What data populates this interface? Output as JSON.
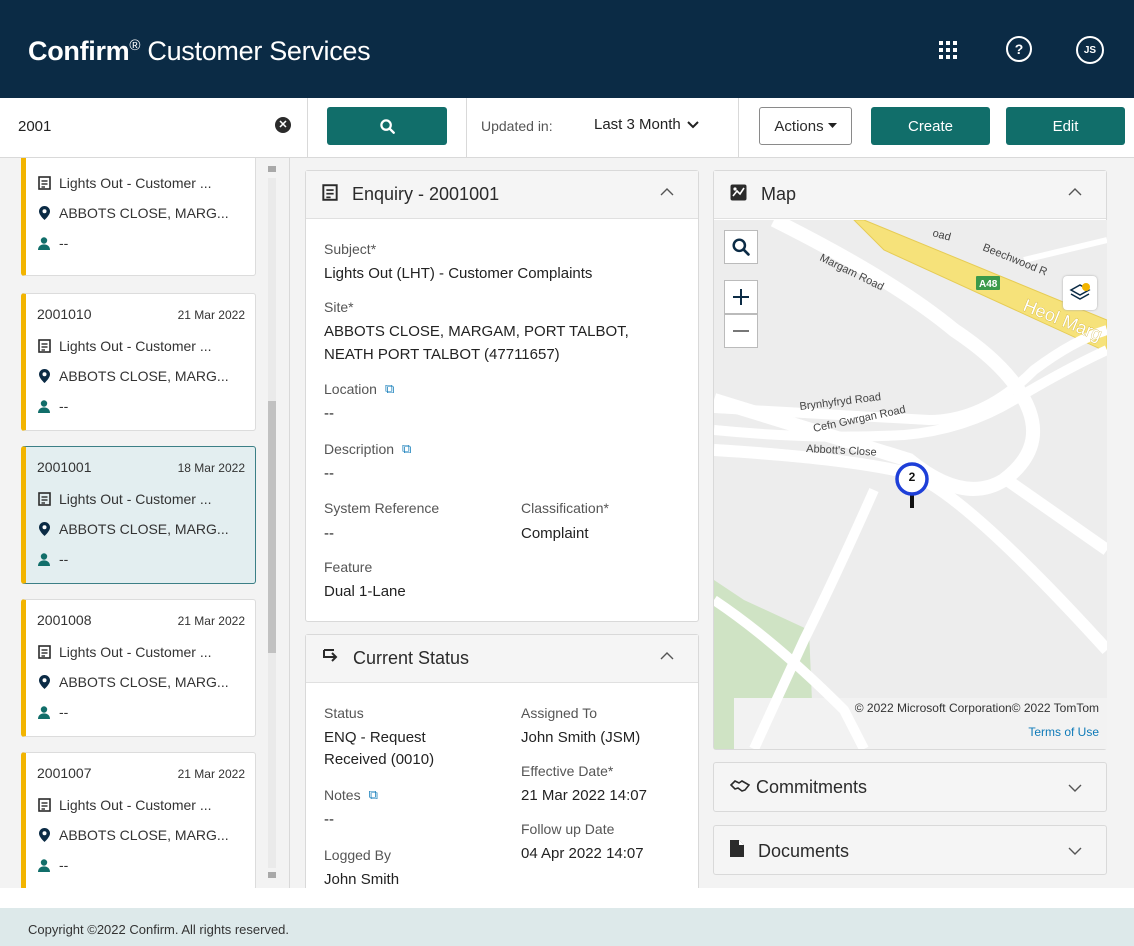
{
  "header": {
    "brand_bold": "Confirm",
    "brand_reg": "®",
    "brand_rest": " Customer Services",
    "help_glyph": "?",
    "user_initials": "JS"
  },
  "toolbar": {
    "search_value": "2001",
    "updated_label": "Updated in:",
    "range_value": "Last 3 Month",
    "actions_label": "Actions",
    "create_label": "Create",
    "edit_label": "Edit"
  },
  "results": [
    {
      "id": "",
      "date": "",
      "subject": "Lights Out - Customer ...",
      "site": "ABBOTS CLOSE, MARG...",
      "person": "--",
      "selected": false
    },
    {
      "id": "2001010",
      "date": "21 Mar 2022",
      "subject": "Lights Out - Customer ...",
      "site": "ABBOTS CLOSE, MARG...",
      "person": "--",
      "selected": false
    },
    {
      "id": "2001001",
      "date": "18 Mar 2022",
      "subject": "Lights Out - Customer ...",
      "site": "ABBOTS CLOSE, MARG...",
      "person": "--",
      "selected": true
    },
    {
      "id": "2001008",
      "date": "21 Mar 2022",
      "subject": "Lights Out - Customer ...",
      "site": "ABBOTS CLOSE, MARG...",
      "person": "--",
      "selected": false
    },
    {
      "id": "2001007",
      "date": "21 Mar 2022",
      "subject": "Lights Out - Customer ...",
      "site": "ABBOTS CLOSE, MARG...",
      "person": "--",
      "selected": false
    }
  ],
  "enquiry": {
    "title": "Enquiry - 2001001",
    "subject_label": "Subject*",
    "subject_value": "Lights Out (LHT) - Customer Complaints",
    "site_label": "Site*",
    "site_value_1": "ABBOTS CLOSE, MARGAM, PORT TALBOT,",
    "site_value_2": "NEATH PORT TALBOT (47711657)",
    "location_label": "Location",
    "location_value": "--",
    "description_label": "Description",
    "description_value": "--",
    "sysref_label": "System Reference",
    "sysref_value": "--",
    "classification_label": "Classification*",
    "classification_value": "Complaint",
    "feature_label": "Feature",
    "feature_value": "Dual 1-Lane"
  },
  "status": {
    "title": "Current Status",
    "status_label": "Status",
    "status_value_1": "ENQ - Request",
    "status_value_2": "Received (0010)",
    "assigned_label": "Assigned To",
    "assigned_value": "John Smith (JSM)",
    "notes_label": "Notes",
    "notes_value": "--",
    "effective_label": "Effective Date*",
    "effective_value": "21 Mar 2022 14:07",
    "logged_label": "Logged By",
    "logged_value": "John Smith",
    "followup_label": "Follow up Date",
    "followup_value": "04 Apr 2022 14:07"
  },
  "map": {
    "title": "Map",
    "roads": {
      "beechwood": "Beechwood R",
      "margam": "Margam Road",
      "heol": "Heol Marg",
      "brynhyfryd": "Brynhyfryd Road",
      "cefn": "Cefn Gwrgan Road",
      "abbotts": "Abbott's Close",
      "road_fragment": "oad",
      "a48": "A48"
    },
    "marker_count": "2",
    "attribution": "© 2022 Microsoft Corporation© 2022 TomTom",
    "terms": "Terms of Use"
  },
  "commitments": {
    "title": "Commitments"
  },
  "documents": {
    "title": "Documents"
  },
  "footer": {
    "copyright": "Copyright ©2022 Confirm. All rights reserved."
  },
  "colors": {
    "header_bg": "#0b2b45",
    "primary": "#116e6a",
    "accent": "#f2b400",
    "link": "#0e7ab8",
    "footer_bg": "#dde9ea"
  }
}
